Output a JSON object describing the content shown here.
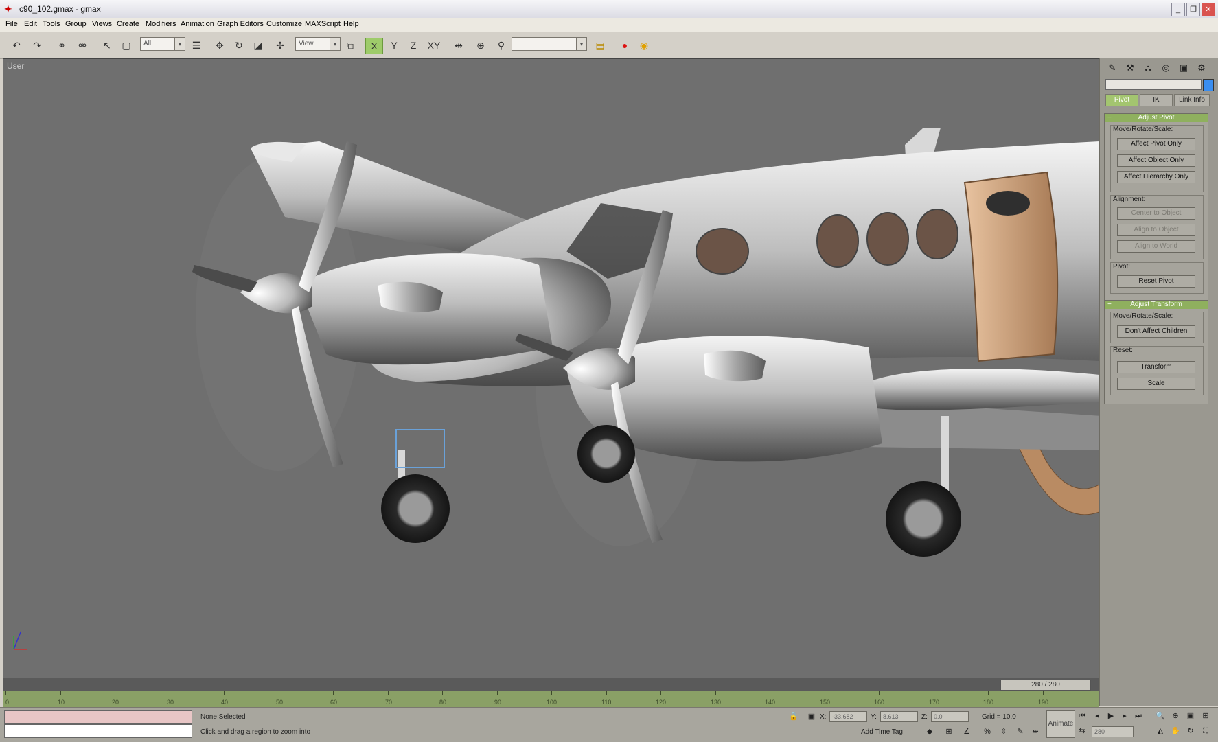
{
  "window": {
    "title": "c90_102.gmax - gmax",
    "minimize": "_",
    "restore": "❐",
    "close": "✕"
  },
  "menu": [
    "File",
    "Edit",
    "Tools",
    "Group",
    "Views",
    "Create",
    "Modifiers",
    "Animation",
    "Graph Editors",
    "Customize",
    "MAXScript",
    "Help"
  ],
  "toolbar": {
    "selection_filter": "All",
    "reference_coord": "View",
    "named_selection": ""
  },
  "viewport": {
    "label": "User"
  },
  "command_panel": {
    "tabs": [
      "Pivot",
      "IK",
      "Link Info"
    ],
    "adjust_pivot": {
      "header": "Adjust Pivot",
      "move_rotate_scale": "Move/Rotate/Scale:",
      "btn_pivot_only": "Affect Pivot Only",
      "btn_object_only": "Affect Object Only",
      "btn_hierarchy_only": "Affect Hierarchy Only",
      "alignment": "Alignment:",
      "btn_center_object": "Center to Object",
      "btn_align_object": "Align to Object",
      "btn_align_world": "Align to World",
      "pivot": "Pivot:",
      "btn_reset_pivot": "Reset Pivot"
    },
    "adjust_transform": {
      "header": "Adjust Transform",
      "move_rotate_scale": "Move/Rotate/Scale:",
      "btn_dont_affect": "Don't Affect Children",
      "reset": "Reset:",
      "btn_transform": "Transform",
      "btn_scale": "Scale"
    }
  },
  "timeline": {
    "frame_display": "280 / 280",
    "ticks": [
      "0",
      "10",
      "20",
      "30",
      "40",
      "50",
      "60",
      "70",
      "80",
      "90",
      "100",
      "110",
      "120",
      "130",
      "140",
      "150",
      "160",
      "170",
      "180",
      "190"
    ]
  },
  "status": {
    "selection": "None Selected",
    "prompt": "Click and drag a region to zoom into",
    "x_label": "X:",
    "x_value": "-33.682",
    "y_label": "Y:",
    "y_value": "8.613",
    "z_label": "Z:",
    "z_value": "0.0",
    "grid": "Grid = 10.0",
    "add_time_tag": "Add Time Tag",
    "animate": "Animate",
    "frame_field": "280"
  }
}
